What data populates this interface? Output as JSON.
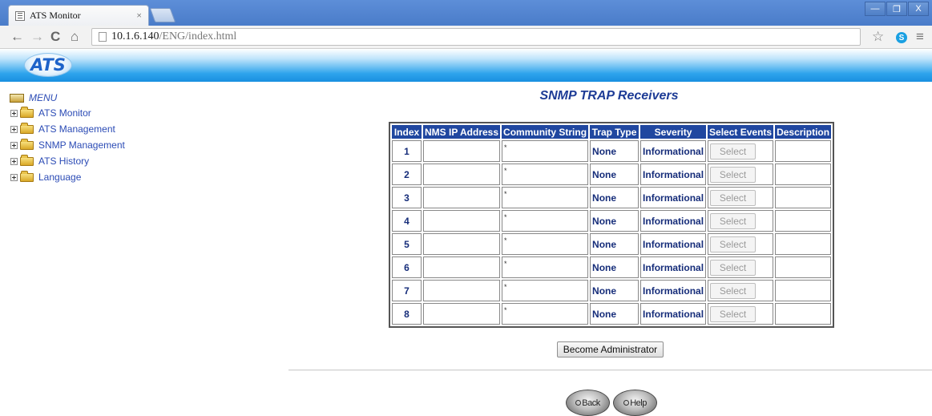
{
  "browser": {
    "tab_title": "ATS Monitor",
    "tab_close": "×",
    "url_host": "10.1.6.140",
    "url_path": "/ENG/index.html",
    "window_minimize": "—",
    "window_restore": "❐",
    "window_close": "X",
    "back": "←",
    "forward": "→",
    "reload": "C",
    "home": "⌂",
    "bookmark_star": "☆",
    "skype": "S",
    "menu": "≡"
  },
  "header": {
    "logo_text": "ATS"
  },
  "menu": {
    "root_label": "MENU",
    "items": [
      {
        "label": "ATS Monitor"
      },
      {
        "label": "ATS Management"
      },
      {
        "label": "SNMP Management"
      },
      {
        "label": "ATS History"
      },
      {
        "label": "Language"
      }
    ]
  },
  "main": {
    "title": "SNMP TRAP Receivers",
    "columns": [
      "Index",
      "NMS IP Address",
      "Community String",
      "Trap Type",
      "Severity",
      "Select Events",
      "Description"
    ],
    "rows": [
      {
        "index": "1",
        "ip": "",
        "community": "*",
        "trap_type": "None",
        "severity": "Informational",
        "select": "Select",
        "description": ""
      },
      {
        "index": "2",
        "ip": "",
        "community": "*",
        "trap_type": "None",
        "severity": "Informational",
        "select": "Select",
        "description": ""
      },
      {
        "index": "3",
        "ip": "",
        "community": "*",
        "trap_type": "None",
        "severity": "Informational",
        "select": "Select",
        "description": ""
      },
      {
        "index": "4",
        "ip": "",
        "community": "*",
        "trap_type": "None",
        "severity": "Informational",
        "select": "Select",
        "description": ""
      },
      {
        "index": "5",
        "ip": "",
        "community": "*",
        "trap_type": "None",
        "severity": "Informational",
        "select": "Select",
        "description": ""
      },
      {
        "index": "6",
        "ip": "",
        "community": "*",
        "trap_type": "None",
        "severity": "Informational",
        "select": "Select",
        "description": ""
      },
      {
        "index": "7",
        "ip": "",
        "community": "*",
        "trap_type": "None",
        "severity": "Informational",
        "select": "Select",
        "description": ""
      },
      {
        "index": "8",
        "ip": "",
        "community": "*",
        "trap_type": "None",
        "severity": "Informational",
        "select": "Select",
        "description": ""
      }
    ],
    "admin_button": "Become Administrator",
    "back_button": "Back",
    "help_button": "Help"
  }
}
